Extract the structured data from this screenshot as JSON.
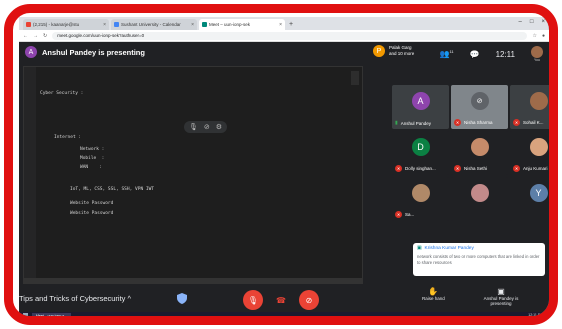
{
  "browser": {
    "tabs": [
      {
        "label": "(2,215) - kaanarje@stu",
        "active": false
      },
      {
        "label": "Sushant University - Calendar",
        "active": false
      },
      {
        "label": "Meet – uun-ionp-sek",
        "active": true
      }
    ],
    "new_tab": "+",
    "url": "meet.google.com/uun-ionp-sek?authuser=0"
  },
  "meet": {
    "presenter": {
      "initial": "A",
      "text": "Anshul Pandey is presenting"
    },
    "pinned": {
      "initial": "P",
      "line1": "Palak Garg",
      "line2": "and 10 more"
    },
    "participants_count": "11",
    "time": "12:11",
    "user_label": "You"
  },
  "editor": {
    "lines": [
      "Cyber Security :",
      "",
      "Internet :",
      "Network : ",
      "Mobile  :",
      "WAN    :",
      "",
      "IoT, ML, CSS, SSL, SSH, VPN IWT",
      "Website Password",
      "Website Password"
    ]
  },
  "participants": [
    {
      "name": "Anshul Pandey",
      "initial": "A",
      "color": "#8e44ad",
      "muted": false
    },
    {
      "name": "Nisha Sharma",
      "initial": "",
      "color": "#5f6368",
      "muted": true
    },
    {
      "name": "Sohail K...",
      "initial": "",
      "color": "#9e6b4a",
      "muted": true
    },
    {
      "name": "Dolly singhan...",
      "initial": "D",
      "color": "#0b8043",
      "muted": true
    },
    {
      "name": "Nisha Sethi",
      "initial": "",
      "color": "#c58b6a",
      "muted": true
    },
    {
      "name": "Anju Kumari",
      "initial": "",
      "color": "#d9a37e",
      "muted": true
    },
    {
      "name": "Sa...",
      "initial": "",
      "color": "#b08968",
      "muted": true
    },
    {
      "name": "",
      "initial": "",
      "color": "#c28a8a",
      "muted": true
    },
    {
      "name": "",
      "initial": "Y",
      "color": "#5c7fa8",
      "muted": true
    }
  ],
  "notification": {
    "from": "Krishna Kumar Pandey",
    "message": "network consists of two or more computers that are linked in order to share resources"
  },
  "bottom": {
    "meeting_name": "Tips and Tricks of Cybersecurity",
    "raise_hand": "Raise hand",
    "presenting_label": "Anshul Pandey is presenting"
  },
  "colors": {
    "frame": "#e01010",
    "end_call": "#ea4335",
    "mic_off": "#d93025"
  },
  "taskbar": {
    "app": "Meet – uun-ionp-s...",
    "clock": "12:11 PM"
  }
}
